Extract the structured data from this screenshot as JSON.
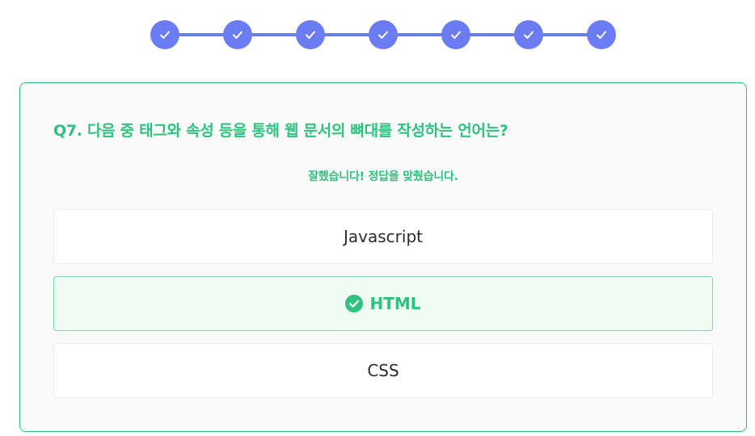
{
  "colors": {
    "accent": "#2ec27e",
    "stepper": "#6b7cf2",
    "card_bg": "#fafafa",
    "correct_bg": "#eefaf3"
  },
  "stepper": {
    "steps": [
      {
        "icon": "check-icon",
        "status": "completed"
      },
      {
        "icon": "check-icon",
        "status": "completed"
      },
      {
        "icon": "check-icon",
        "status": "completed"
      },
      {
        "icon": "check-icon",
        "status": "completed"
      },
      {
        "icon": "check-icon",
        "status": "completed"
      },
      {
        "icon": "check-icon",
        "status": "completed"
      },
      {
        "icon": "check-icon",
        "status": "completed"
      }
    ]
  },
  "quiz": {
    "question": "Q7. 다음 중 태그와 속성 등을 통해 웹 문서의 뼈대를 작성하는 언어는?",
    "feedback": "잘했습니다! 정답을 맞췄습니다.",
    "options": [
      {
        "label": "Javascript",
        "correct": false
      },
      {
        "label": "HTML",
        "correct": true,
        "icon": "check-circle-icon"
      },
      {
        "label": "CSS",
        "correct": false
      }
    ]
  }
}
